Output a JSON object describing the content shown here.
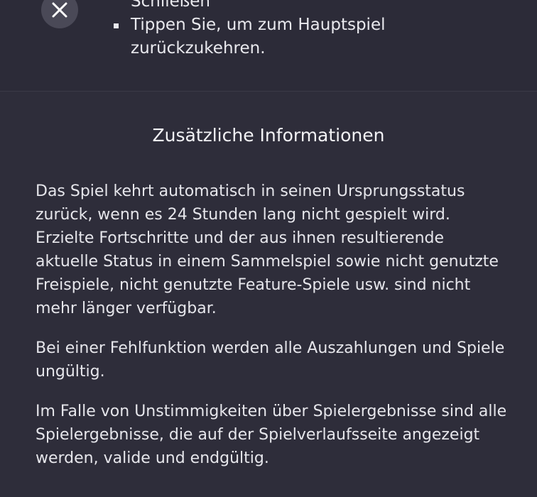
{
  "close_button": {
    "icon": "close-icon",
    "label": "×"
  },
  "instructions": {
    "items": [
      {
        "text": "Schließen"
      },
      {
        "text": "Tippen Sie, um zum Hauptspiel zurückzukehren."
      }
    ]
  },
  "additional_info": {
    "title": "Zusätzliche Informationen",
    "paragraphs": [
      "Das Spiel kehrt automatisch in seinen Ursprungsstatus zurück, wenn es 24 Stunden lang nicht gespielt wird. Erzielte Fortschritte und der aus ihnen resultierende aktuelle Status in einem Sammelspiel sowie nicht genutzte Freispiele, nicht genutzte Feature-Spiele usw. sind nicht mehr länger verfügbar.",
      "Bei einer Fehlfunktion werden alle Auszahlungen und Spiele ungültig.",
      "Im Falle von Unstimmigkeiten über Spielergebnisse sind alle Spielergebnisse, die auf der Spielverlaufsseite angezeigt werden, valide und endgültig."
    ]
  },
  "colors": {
    "background": "#2e2d3a",
    "text": "#e9e9ee",
    "close_button_bg": "#4a4957"
  }
}
